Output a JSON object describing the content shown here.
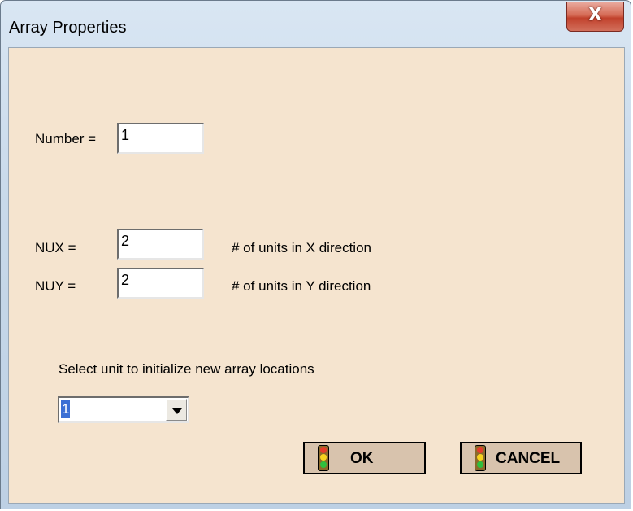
{
  "window": {
    "title": "Array Properties",
    "close_label": "X"
  },
  "form": {
    "number_label": "Number =",
    "number_value": "1",
    "nux_label": "NUX =",
    "nux_value": "2",
    "nux_hint": "# of units in X direction",
    "nuy_label": "NUY =",
    "nuy_value": "2",
    "nuy_hint": "# of units in Y direction",
    "select_label": "Select unit to initialize new array locations",
    "select_value": "1"
  },
  "buttons": {
    "ok_label": "OK",
    "cancel_label": "CANCEL"
  },
  "icons": {
    "traffic_light": "traffic-light-icon",
    "dropdown": "chevron-down-icon"
  },
  "colors": {
    "client_bg": "#f5e4cf",
    "button_bg": "#d8c3ad",
    "close_red": "#c1412c"
  }
}
